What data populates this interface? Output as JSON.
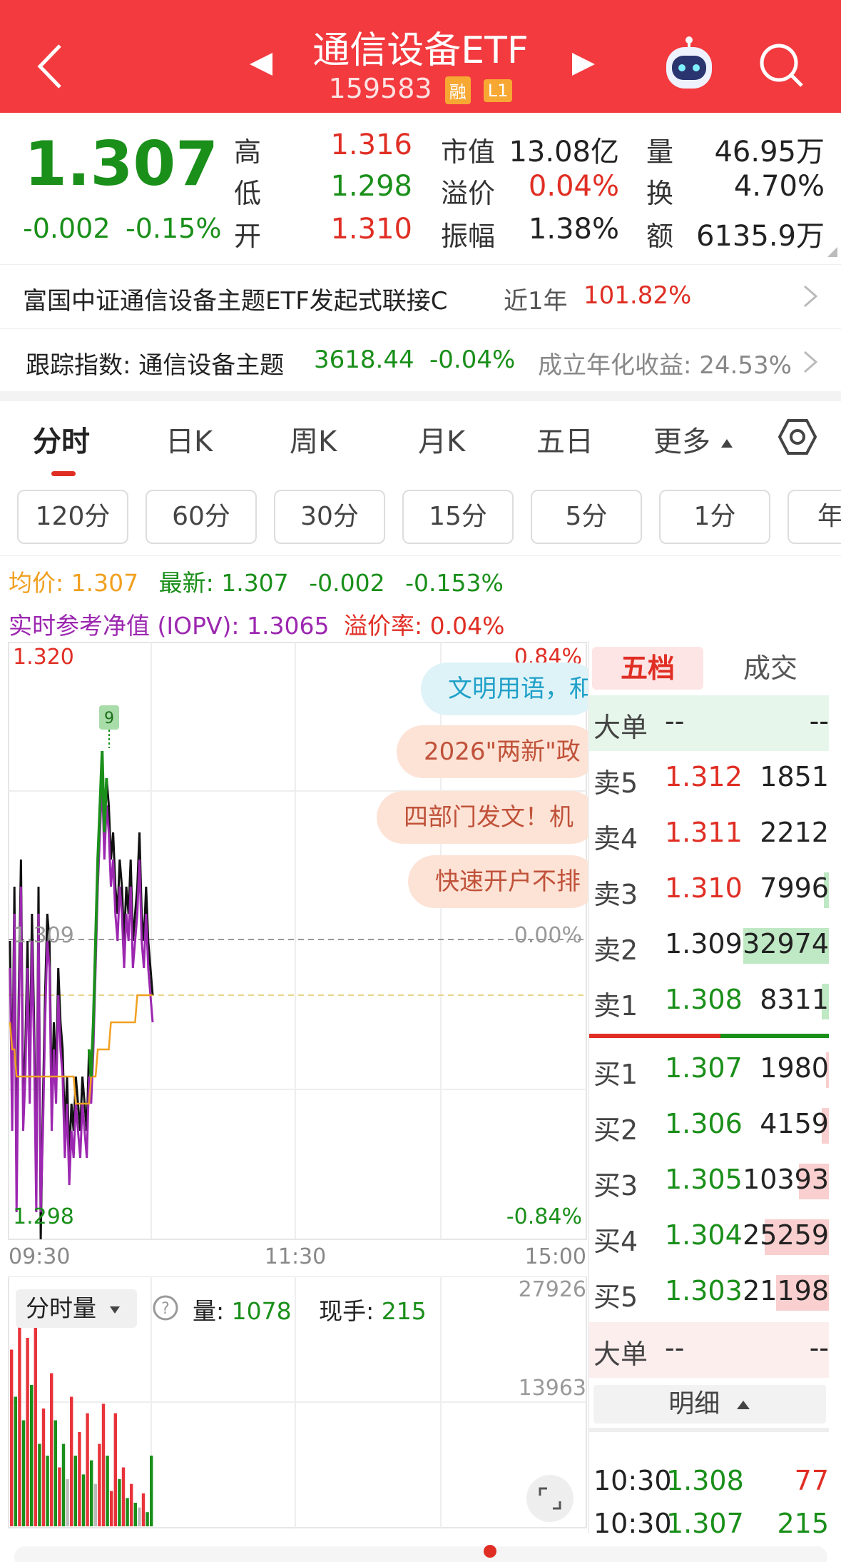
{
  "header": {
    "title": "通信设备ETF",
    "code": "159583",
    "badge1": "融",
    "badge2": "L1"
  },
  "quote": {
    "price": "1.307",
    "change": "-0.002",
    "change_pct": "-0.15%",
    "high_label": "高",
    "high": "1.316",
    "low_label": "低",
    "low": "1.298",
    "open_label": "开",
    "open": "1.310",
    "mktcap_label": "市值",
    "mktcap": "13.08亿",
    "premium_label": "溢价",
    "premium": "0.04%",
    "amplitude_label": "振幅",
    "amplitude": "1.38%",
    "vol_label": "量",
    "vol": "46.95万",
    "turnover_label": "换",
    "turnover": "4.70%",
    "amount_label": "额",
    "amount": "6135.9万"
  },
  "fund": {
    "name": "富国中证通信设备主题ETF发起式联接C",
    "period": "近1年",
    "return": "101.82%"
  },
  "index": {
    "label": "跟踪指数: 通信设备主题",
    "value": "3618.44",
    "change": "-0.04%",
    "annual": "成立年化收益: 24.53%"
  },
  "tabs": [
    "分时",
    "日K",
    "周K",
    "月K",
    "五日",
    "更多"
  ],
  "periods": [
    "120分",
    "60分",
    "30分",
    "15分",
    "5分",
    "1分",
    "年"
  ],
  "info": {
    "avg_label": "均价: ",
    "avg": "1.307",
    "latest_label": "最新: ",
    "latest": "1.307",
    "latest_change": "-0.002",
    "latest_pct": "-0.153%",
    "iopv_label": "实时参考净值 (IOPV): ",
    "iopv": "1.3065",
    "prem_label": "溢价率: ",
    "prem": "0.04%"
  },
  "chart_data": {
    "type": "line",
    "y_max_label": "1.320",
    "y_min_label": "1.298",
    "y_mid_label": "1.309",
    "pct_max_label": "0.84%",
    "pct_mid_label": "0.00%",
    "pct_min_label": "-0.84%",
    "x_labels": [
      "09:30",
      "11:30",
      "15:00"
    ],
    "ylim": [
      1.298,
      1.32
    ],
    "marker": "9",
    "series": [
      {
        "color": "#111111",
        "values": [
          1.309,
          1.303,
          1.311,
          1.3,
          1.307,
          1.312,
          1.303,
          1.305,
          1.309,
          1.304,
          1.31,
          1.306,
          1.3,
          1.311,
          1.298,
          1.303,
          1.307,
          1.31,
          1.309,
          1.303,
          1.306,
          1.304,
          1.308,
          1.306,
          1.305,
          1.302,
          1.304,
          1.301,
          1.303,
          1.302,
          1.304,
          1.303,
          1.302,
          1.304,
          1.303,
          1.302,
          1.305,
          1.304,
          1.306,
          1.309,
          1.312,
          1.314,
          1.316,
          1.313,
          1.315,
          1.314,
          1.312,
          1.313,
          1.311,
          1.31,
          1.312,
          1.311,
          1.309,
          1.311,
          1.31,
          1.312,
          1.309,
          1.31,
          1.311,
          1.313,
          1.31,
          1.309,
          1.311,
          1.309,
          1.308,
          1.307
        ]
      },
      {
        "color": "#9c27b0",
        "values": [
          1.308,
          1.302,
          1.31,
          1.299,
          1.306,
          1.311,
          1.302,
          1.304,
          1.308,
          1.303,
          1.309,
          1.305,
          1.299,
          1.31,
          1.299,
          1.302,
          1.306,
          1.309,
          1.308,
          1.302,
          1.305,
          1.303,
          1.307,
          1.305,
          1.304,
          1.301,
          1.303,
          1.3,
          1.302,
          1.301,
          1.303,
          1.302,
          1.301,
          1.303,
          1.302,
          1.301,
          1.304,
          1.303,
          1.305,
          1.308,
          1.311,
          1.313,
          1.315,
          1.312,
          1.314,
          1.313,
          1.311,
          1.312,
          1.31,
          1.309,
          1.311,
          1.31,
          1.308,
          1.31,
          1.309,
          1.311,
          1.308,
          1.309,
          1.31,
          1.312,
          1.309,
          1.308,
          1.31,
          1.308,
          1.307,
          1.306
        ]
      },
      {
        "color": "#f0a020",
        "values": [
          1.306,
          1.305,
          1.305,
          1.304,
          1.304,
          1.304,
          1.304,
          1.304,
          1.304,
          1.304,
          1.304,
          1.304,
          1.304,
          1.304,
          1.304,
          1.304,
          1.304,
          1.304,
          1.304,
          1.304,
          1.304,
          1.304,
          1.304,
          1.304,
          1.304,
          1.304,
          1.304,
          1.304,
          1.304,
          1.304,
          1.303,
          1.303,
          1.303,
          1.303,
          1.303,
          1.303,
          1.303,
          1.304,
          1.304,
          1.304,
          1.305,
          1.305,
          1.305,
          1.305,
          1.305,
          1.305,
          1.306,
          1.306,
          1.306,
          1.306,
          1.306,
          1.306,
          1.306,
          1.306,
          1.306,
          1.306,
          1.306,
          1.306,
          1.307,
          1.307,
          1.307,
          1.307,
          1.307,
          1.307,
          1.307,
          1.307
        ]
      }
    ]
  },
  "news": [
    {
      "text": "文明用语，和",
      "bg": "#def3f8",
      "color": "#1fa0c8"
    },
    {
      "text": "2026\"两新\"政",
      "bg": "#fde3d6",
      "color": "#c0523a"
    },
    {
      "text": "四部门发文！机",
      "bg": "#fde3d6",
      "color": "#c0523a"
    },
    {
      "text": "快速开户不排",
      "bg": "#fde3d6",
      "color": "#c0523a"
    }
  ],
  "volume": {
    "select": "分时量",
    "vol_label": "量: ",
    "vol": "1078",
    "now_label": "现手: ",
    "now": "215",
    "max_label": "27926",
    "mid_label": "13963",
    "bars": [
      {
        "v": 0.75,
        "c": "red"
      },
      {
        "v": 0.55,
        "c": "green"
      },
      {
        "v": 0.85,
        "c": "red"
      },
      {
        "v": 0.45,
        "c": "green"
      },
      {
        "v": 0.8,
        "c": "red"
      },
      {
        "v": 0.6,
        "c": "green"
      },
      {
        "v": 0.95,
        "c": "red"
      },
      {
        "v": 0.35,
        "c": "green"
      },
      {
        "v": 0.5,
        "c": "red"
      },
      {
        "v": 0.3,
        "c": "green"
      },
      {
        "v": 0.65,
        "c": "red"
      },
      {
        "v": 0.45,
        "c": "green"
      },
      {
        "v": 0.25,
        "c": "red"
      },
      {
        "v": 0.35,
        "c": "green"
      },
      {
        "v": 0.2,
        "c": "grey"
      },
      {
        "v": 0.55,
        "c": "red"
      },
      {
        "v": 0.3,
        "c": "green"
      },
      {
        "v": 0.4,
        "c": "red"
      },
      {
        "v": 0.22,
        "c": "green"
      },
      {
        "v": 0.48,
        "c": "red"
      },
      {
        "v": 0.28,
        "c": "green"
      },
      {
        "v": 0.18,
        "c": "grey"
      },
      {
        "v": 0.35,
        "c": "red"
      },
      {
        "v": 0.52,
        "c": "red"
      },
      {
        "v": 0.3,
        "c": "green"
      },
      {
        "v": 0.15,
        "c": "red"
      },
      {
        "v": 0.48,
        "c": "red"
      },
      {
        "v": 0.2,
        "c": "green"
      },
      {
        "v": 0.25,
        "c": "red"
      },
      {
        "v": 0.12,
        "c": "green"
      },
      {
        "v": 0.18,
        "c": "red"
      },
      {
        "v": 0.1,
        "c": "green"
      },
      {
        "v": 0.08,
        "c": "grey"
      },
      {
        "v": 0.14,
        "c": "red"
      },
      {
        "v": 0.06,
        "c": "green"
      },
      {
        "v": 0.3,
        "c": "green"
      }
    ]
  },
  "side": {
    "tab1": "五档",
    "tab2": "成交",
    "big_label": "大单",
    "big_v1": "--",
    "big_v2": "--",
    "asks": [
      {
        "l": "卖5",
        "p": "1.312",
        "v": "1851",
        "pc": "red",
        "bar": 0.0
      },
      {
        "l": "卖4",
        "p": "1.311",
        "v": "2212",
        "pc": "red",
        "bar": 0.0
      },
      {
        "l": "卖3",
        "p": "1.310",
        "v": "7996",
        "pc": "red",
        "bar": 0.06
      },
      {
        "l": "卖2",
        "p": "1.309",
        "v": "32974",
        "pc": "dark",
        "bar": 1.0
      },
      {
        "l": "卖1",
        "p": "1.308",
        "v": "8311",
        "pc": "green",
        "bar": 0.08
      }
    ],
    "bids": [
      {
        "l": "买1",
        "p": "1.307",
        "v": "1980",
        "pc": "green",
        "bar": 0.03
      },
      {
        "l": "买2",
        "p": "1.306",
        "v": "4159",
        "pc": "green",
        "bar": 0.08
      },
      {
        "l": "买3",
        "p": "1.305",
        "v": "10393",
        "pc": "green",
        "bar": 0.35
      },
      {
        "l": "买4",
        "p": "1.304",
        "v": "25259",
        "pc": "green",
        "bar": 0.75
      },
      {
        "l": "买5",
        "p": "1.303",
        "v": "21198",
        "pc": "green",
        "bar": 0.62
      }
    ],
    "detail_label": "明细",
    "trades": [
      {
        "t": "10:30",
        "p": "1.308",
        "v": "77",
        "vc": "red"
      },
      {
        "t": "10:30",
        "p": "1.307",
        "v": "215",
        "vc": "green"
      }
    ]
  }
}
